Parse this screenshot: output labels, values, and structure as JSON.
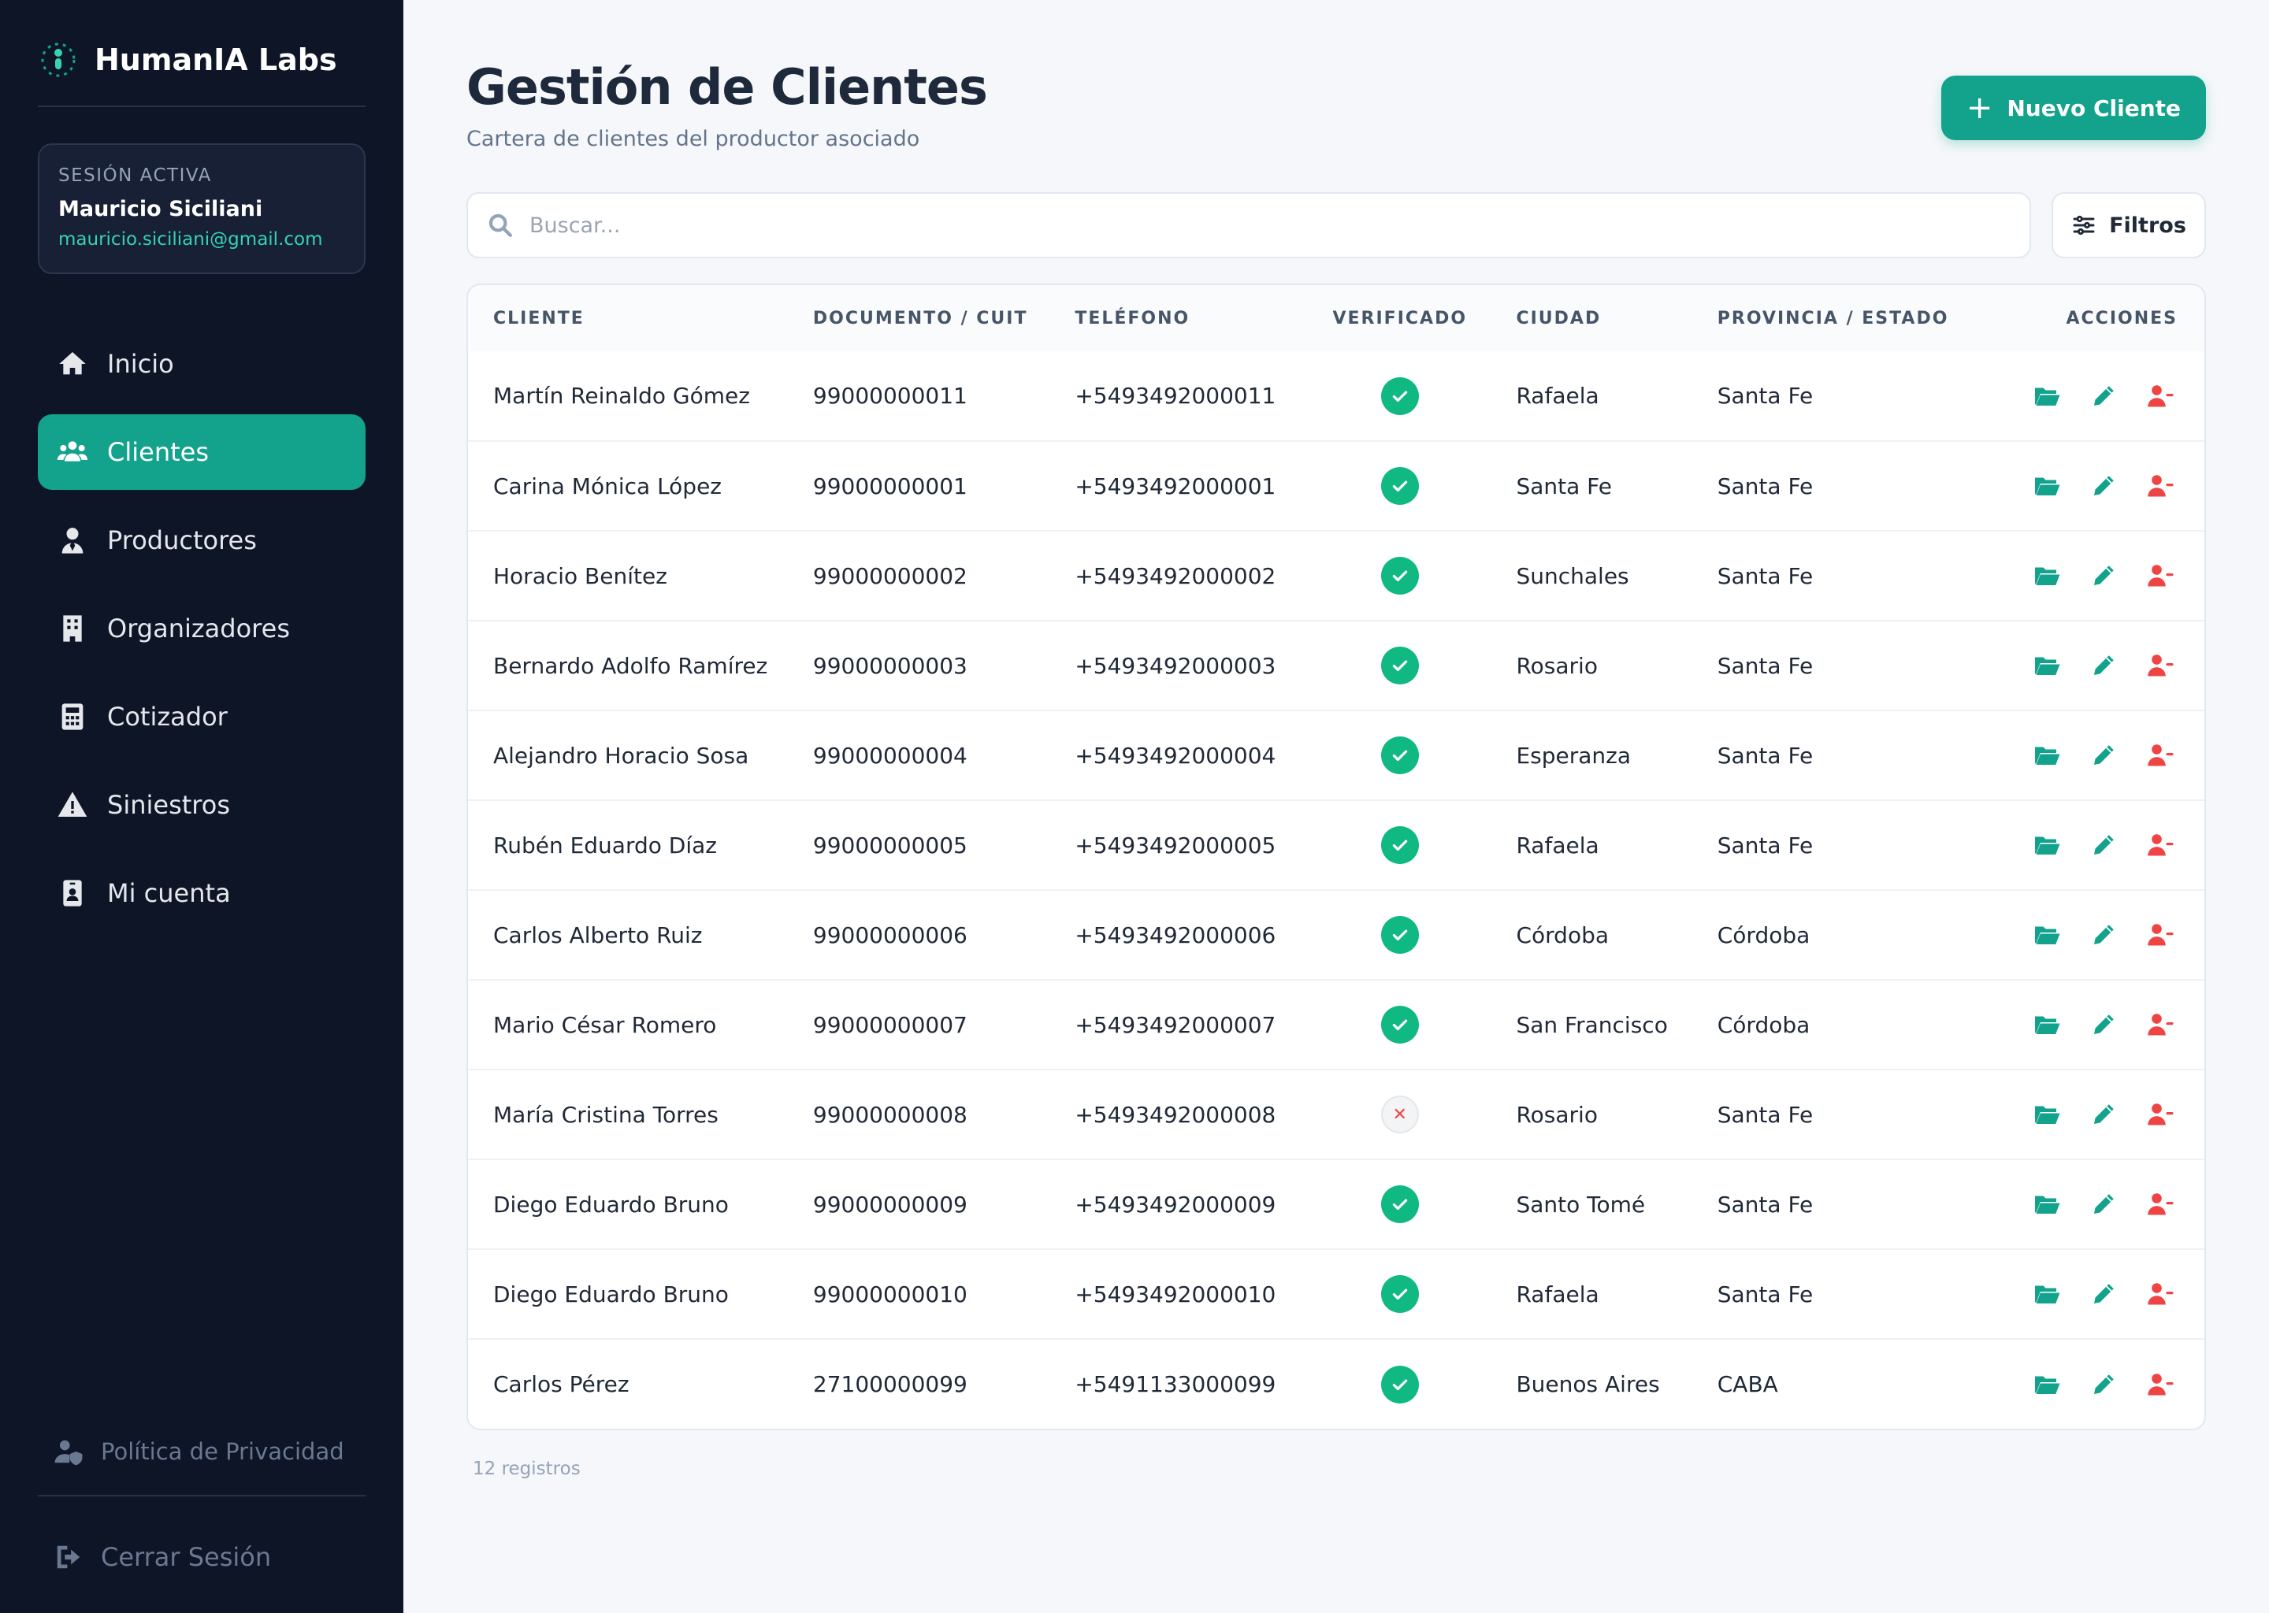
{
  "brand": {
    "name": "HumanIA Labs"
  },
  "session": {
    "title": "Sesión activa",
    "user": "Mauricio Siciliani",
    "email": "mauricio.siciliani@gmail.com"
  },
  "nav": [
    {
      "label": "Inicio",
      "icon": "home-icon",
      "active": false
    },
    {
      "label": "Clientes",
      "icon": "users-icon",
      "active": true
    },
    {
      "label": "Productores",
      "icon": "user-tie-icon",
      "active": false
    },
    {
      "label": "Organizadores",
      "icon": "building-icon",
      "active": false
    },
    {
      "label": "Cotizador",
      "icon": "calculator-icon",
      "active": false
    },
    {
      "label": "Siniestros",
      "icon": "warning-icon",
      "active": false
    },
    {
      "label": "Mi cuenta",
      "icon": "id-badge-icon",
      "active": false
    }
  ],
  "sidebar_bottom": {
    "privacy": "Política de Privacidad",
    "logout": "Cerrar Sesión"
  },
  "header": {
    "title": "Gestión de Clientes",
    "subtitle": "Cartera de clientes del productor asociado",
    "new_button": "Nuevo Cliente"
  },
  "search": {
    "placeholder": "Buscar..."
  },
  "filters_label": "Filtros",
  "table": {
    "columns": [
      "Cliente",
      "Documento / CUIT",
      "Teléfono",
      "Verificado",
      "Ciudad",
      "Provincia / Estado",
      "Acciones"
    ],
    "rows": [
      {
        "name": "Martín Reinaldo Gómez",
        "doc": "99000000011",
        "phone": "+5493492000011",
        "verified": true,
        "city": "Rafaela",
        "province": "Santa Fe"
      },
      {
        "name": "Carina Mónica López",
        "doc": "99000000001",
        "phone": "+5493492000001",
        "verified": true,
        "city": "Santa Fe",
        "province": "Santa Fe"
      },
      {
        "name": "Horacio Benítez",
        "doc": "99000000002",
        "phone": "+5493492000002",
        "verified": true,
        "city": "Sunchales",
        "province": "Santa Fe"
      },
      {
        "name": "Bernardo Adolfo Ramírez",
        "doc": "99000000003",
        "phone": "+5493492000003",
        "verified": true,
        "city": "Rosario",
        "province": "Santa Fe"
      },
      {
        "name": "Alejandro Horacio Sosa",
        "doc": "99000000004",
        "phone": "+5493492000004",
        "verified": true,
        "city": "Esperanza",
        "province": "Santa Fe"
      },
      {
        "name": "Rubén Eduardo Díaz",
        "doc": "99000000005",
        "phone": "+5493492000005",
        "verified": true,
        "city": "Rafaela",
        "province": "Santa Fe"
      },
      {
        "name": "Carlos Alberto Ruiz",
        "doc": "99000000006",
        "phone": "+5493492000006",
        "verified": true,
        "city": "Córdoba",
        "province": "Córdoba"
      },
      {
        "name": "Mario César Romero",
        "doc": "99000000007",
        "phone": "+5493492000007",
        "verified": true,
        "city": "San Francisco",
        "province": "Córdoba"
      },
      {
        "name": "María Cristina Torres",
        "doc": "99000000008",
        "phone": "+5493492000008",
        "verified": false,
        "city": "Rosario",
        "province": "Santa Fe"
      },
      {
        "name": "Diego Eduardo Bruno",
        "doc": "99000000009",
        "phone": "+5493492000009",
        "verified": true,
        "city": "Santo Tomé",
        "province": "Santa Fe"
      },
      {
        "name": "Diego Eduardo Bruno",
        "doc": "99000000010",
        "phone": "+5493492000010",
        "verified": true,
        "city": "Rafaela",
        "province": "Santa Fe"
      },
      {
        "name": "Carlos Pérez",
        "doc": "27100000099",
        "phone": "+5491133000099",
        "verified": true,
        "city": "Buenos Aires",
        "province": "CABA"
      }
    ]
  },
  "footer": {
    "count": "12 registros"
  },
  "colors": {
    "accent": "#13a28c",
    "sidebar_bg": "#0d1527",
    "verified": "#10b981",
    "danger": "#ef4444"
  }
}
